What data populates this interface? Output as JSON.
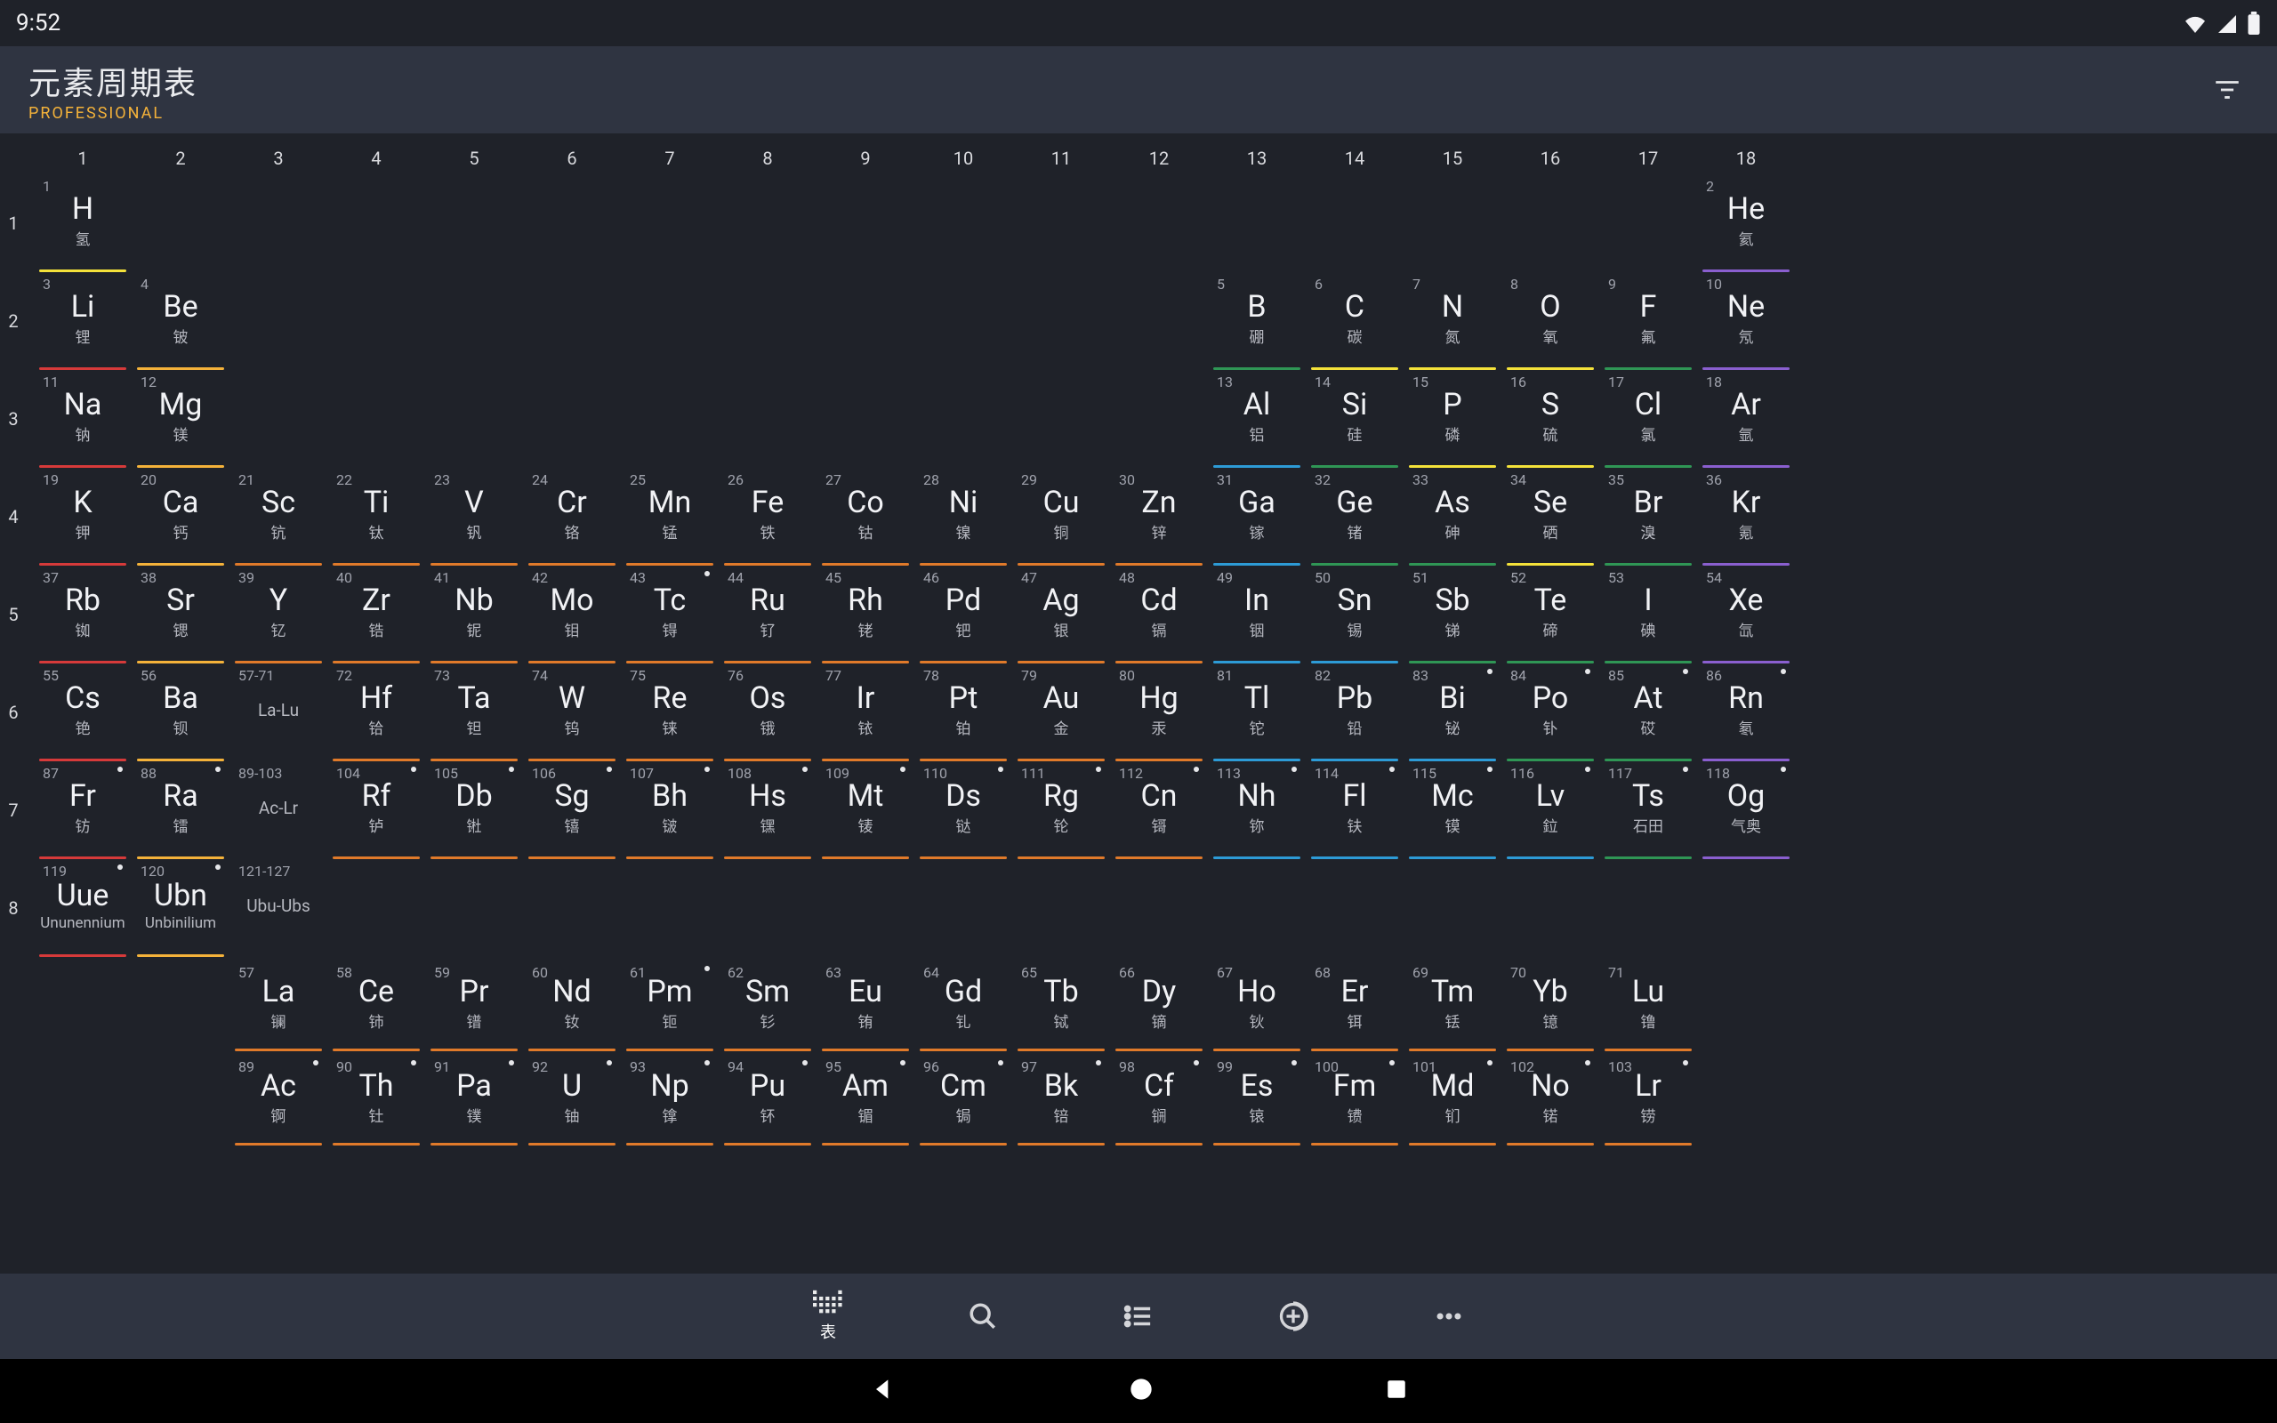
{
  "status": {
    "time": "9:52"
  },
  "header": {
    "title": "元素周期表",
    "subtitle": "PROFESSIONAL"
  },
  "nav": {
    "table": "表"
  },
  "colors": {
    "alkali": "#d63a3a",
    "alkaline": "#f4b23a",
    "transition": "#e07a2a",
    "post": "#2d9bd6",
    "metalloid": "#2f9655",
    "nonmetal": "#f4e23a",
    "halogen": "#2f9655",
    "noble": "#8a5fcf",
    "lanth": "#e07a2a",
    "actin": "#e07a2a",
    "unknown": "#8a5fcf"
  },
  "groups": [
    "1",
    "2",
    "3",
    "4",
    "5",
    "6",
    "7",
    "8",
    "9",
    "10",
    "11",
    "12",
    "13",
    "14",
    "15",
    "16",
    "17",
    "18"
  ],
  "periods": [
    "1",
    "2",
    "3",
    "4",
    "5",
    "6",
    "7",
    "8"
  ],
  "elements": [
    {
      "n": "1",
      "s": "H",
      "cn": "氢",
      "r": 1,
      "c": 1,
      "cat": "nonmetal"
    },
    {
      "n": "2",
      "s": "He",
      "cn": "氦",
      "r": 1,
      "c": 18,
      "cat": "noble"
    },
    {
      "n": "3",
      "s": "Li",
      "cn": "锂",
      "r": 2,
      "c": 1,
      "cat": "alkali"
    },
    {
      "n": "4",
      "s": "Be",
      "cn": "铍",
      "r": 2,
      "c": 2,
      "cat": "alkaline"
    },
    {
      "n": "5",
      "s": "B",
      "cn": "硼",
      "r": 2,
      "c": 13,
      "cat": "metalloid"
    },
    {
      "n": "6",
      "s": "C",
      "cn": "碳",
      "r": 2,
      "c": 14,
      "cat": "nonmetal"
    },
    {
      "n": "7",
      "s": "N",
      "cn": "氮",
      "r": 2,
      "c": 15,
      "cat": "nonmetal"
    },
    {
      "n": "8",
      "s": "O",
      "cn": "氧",
      "r": 2,
      "c": 16,
      "cat": "nonmetal"
    },
    {
      "n": "9",
      "s": "F",
      "cn": "氟",
      "r": 2,
      "c": 17,
      "cat": "halogen"
    },
    {
      "n": "10",
      "s": "Ne",
      "cn": "氖",
      "r": 2,
      "c": 18,
      "cat": "noble"
    },
    {
      "n": "11",
      "s": "Na",
      "cn": "钠",
      "r": 3,
      "c": 1,
      "cat": "alkali"
    },
    {
      "n": "12",
      "s": "Mg",
      "cn": "镁",
      "r": 3,
      "c": 2,
      "cat": "alkaline"
    },
    {
      "n": "13",
      "s": "Al",
      "cn": "铝",
      "r": 3,
      "c": 13,
      "cat": "post"
    },
    {
      "n": "14",
      "s": "Si",
      "cn": "硅",
      "r": 3,
      "c": 14,
      "cat": "metalloid"
    },
    {
      "n": "15",
      "s": "P",
      "cn": "磷",
      "r": 3,
      "c": 15,
      "cat": "nonmetal"
    },
    {
      "n": "16",
      "s": "S",
      "cn": "硫",
      "r": 3,
      "c": 16,
      "cat": "nonmetal"
    },
    {
      "n": "17",
      "s": "Cl",
      "cn": "氯",
      "r": 3,
      "c": 17,
      "cat": "halogen"
    },
    {
      "n": "18",
      "s": "Ar",
      "cn": "氩",
      "r": 3,
      "c": 18,
      "cat": "noble"
    },
    {
      "n": "19",
      "s": "K",
      "cn": "钾",
      "r": 4,
      "c": 1,
      "cat": "alkali"
    },
    {
      "n": "20",
      "s": "Ca",
      "cn": "钙",
      "r": 4,
      "c": 2,
      "cat": "alkaline"
    },
    {
      "n": "21",
      "s": "Sc",
      "cn": "钪",
      "r": 4,
      "c": 3,
      "cat": "transition"
    },
    {
      "n": "22",
      "s": "Ti",
      "cn": "钛",
      "r": 4,
      "c": 4,
      "cat": "transition"
    },
    {
      "n": "23",
      "s": "V",
      "cn": "钒",
      "r": 4,
      "c": 5,
      "cat": "transition"
    },
    {
      "n": "24",
      "s": "Cr",
      "cn": "铬",
      "r": 4,
      "c": 6,
      "cat": "transition"
    },
    {
      "n": "25",
      "s": "Mn",
      "cn": "锰",
      "r": 4,
      "c": 7,
      "cat": "transition"
    },
    {
      "n": "26",
      "s": "Fe",
      "cn": "铁",
      "r": 4,
      "c": 8,
      "cat": "transition"
    },
    {
      "n": "27",
      "s": "Co",
      "cn": "钴",
      "r": 4,
      "c": 9,
      "cat": "transition"
    },
    {
      "n": "28",
      "s": "Ni",
      "cn": "镍",
      "r": 4,
      "c": 10,
      "cat": "transition"
    },
    {
      "n": "29",
      "s": "Cu",
      "cn": "铜",
      "r": 4,
      "c": 11,
      "cat": "transition"
    },
    {
      "n": "30",
      "s": "Zn",
      "cn": "锌",
      "r": 4,
      "c": 12,
      "cat": "transition"
    },
    {
      "n": "31",
      "s": "Ga",
      "cn": "镓",
      "r": 4,
      "c": 13,
      "cat": "post"
    },
    {
      "n": "32",
      "s": "Ge",
      "cn": "锗",
      "r": 4,
      "c": 14,
      "cat": "metalloid"
    },
    {
      "n": "33",
      "s": "As",
      "cn": "砷",
      "r": 4,
      "c": 15,
      "cat": "metalloid"
    },
    {
      "n": "34",
      "s": "Se",
      "cn": "硒",
      "r": 4,
      "c": 16,
      "cat": "nonmetal"
    },
    {
      "n": "35",
      "s": "Br",
      "cn": "溴",
      "r": 4,
      "c": 17,
      "cat": "halogen"
    },
    {
      "n": "36",
      "s": "Kr",
      "cn": "氪",
      "r": 4,
      "c": 18,
      "cat": "noble"
    },
    {
      "n": "37",
      "s": "Rb",
      "cn": "铷",
      "r": 5,
      "c": 1,
      "cat": "alkali"
    },
    {
      "n": "38",
      "s": "Sr",
      "cn": "锶",
      "r": 5,
      "c": 2,
      "cat": "alkaline"
    },
    {
      "n": "39",
      "s": "Y",
      "cn": "钇",
      "r": 5,
      "c": 3,
      "cat": "transition"
    },
    {
      "n": "40",
      "s": "Zr",
      "cn": "锆",
      "r": 5,
      "c": 4,
      "cat": "transition"
    },
    {
      "n": "41",
      "s": "Nb",
      "cn": "铌",
      "r": 5,
      "c": 5,
      "cat": "transition"
    },
    {
      "n": "42",
      "s": "Mo",
      "cn": "钼",
      "r": 5,
      "c": 6,
      "cat": "transition"
    },
    {
      "n": "43",
      "s": "Tc",
      "cn": "锝",
      "r": 5,
      "c": 7,
      "cat": "transition",
      "dot": true
    },
    {
      "n": "44",
      "s": "Ru",
      "cn": "钌",
      "r": 5,
      "c": 8,
      "cat": "transition"
    },
    {
      "n": "45",
      "s": "Rh",
      "cn": "铑",
      "r": 5,
      "c": 9,
      "cat": "transition"
    },
    {
      "n": "46",
      "s": "Pd",
      "cn": "钯",
      "r": 5,
      "c": 10,
      "cat": "transition"
    },
    {
      "n": "47",
      "s": "Ag",
      "cn": "银",
      "r": 5,
      "c": 11,
      "cat": "transition"
    },
    {
      "n": "48",
      "s": "Cd",
      "cn": "镉",
      "r": 5,
      "c": 12,
      "cat": "transition"
    },
    {
      "n": "49",
      "s": "In",
      "cn": "铟",
      "r": 5,
      "c": 13,
      "cat": "post"
    },
    {
      "n": "50",
      "s": "Sn",
      "cn": "锡",
      "r": 5,
      "c": 14,
      "cat": "post"
    },
    {
      "n": "51",
      "s": "Sb",
      "cn": "锑",
      "r": 5,
      "c": 15,
      "cat": "metalloid"
    },
    {
      "n": "52",
      "s": "Te",
      "cn": "碲",
      "r": 5,
      "c": 16,
      "cat": "metalloid"
    },
    {
      "n": "53",
      "s": "I",
      "cn": "碘",
      "r": 5,
      "c": 17,
      "cat": "halogen"
    },
    {
      "n": "54",
      "s": "Xe",
      "cn": "氙",
      "r": 5,
      "c": 18,
      "cat": "noble"
    },
    {
      "n": "55",
      "s": "Cs",
      "cn": "铯",
      "r": 6,
      "c": 1,
      "cat": "alkali"
    },
    {
      "n": "56",
      "s": "Ba",
      "cn": "钡",
      "r": 6,
      "c": 2,
      "cat": "alkaline"
    },
    {
      "n": "57-71",
      "s": "La-Lu",
      "sub": "",
      "r": 6,
      "c": 3,
      "cat": "lanth",
      "placeholder": true
    },
    {
      "n": "72",
      "s": "Hf",
      "cn": "铪",
      "r": 6,
      "c": 4,
      "cat": "transition"
    },
    {
      "n": "73",
      "s": "Ta",
      "cn": "钽",
      "r": 6,
      "c": 5,
      "cat": "transition"
    },
    {
      "n": "74",
      "s": "W",
      "cn": "钨",
      "r": 6,
      "c": 6,
      "cat": "transition"
    },
    {
      "n": "75",
      "s": "Re",
      "cn": "铼",
      "r": 6,
      "c": 7,
      "cat": "transition"
    },
    {
      "n": "76",
      "s": "Os",
      "cn": "锇",
      "r": 6,
      "c": 8,
      "cat": "transition"
    },
    {
      "n": "77",
      "s": "Ir",
      "cn": "铱",
      "r": 6,
      "c": 9,
      "cat": "transition"
    },
    {
      "n": "78",
      "s": "Pt",
      "cn": "铂",
      "r": 6,
      "c": 10,
      "cat": "transition"
    },
    {
      "n": "79",
      "s": "Au",
      "cn": "金",
      "r": 6,
      "c": 11,
      "cat": "transition"
    },
    {
      "n": "80",
      "s": "Hg",
      "cn": "汞",
      "r": 6,
      "c": 12,
      "cat": "transition"
    },
    {
      "n": "81",
      "s": "Tl",
      "cn": "铊",
      "r": 6,
      "c": 13,
      "cat": "post"
    },
    {
      "n": "82",
      "s": "Pb",
      "cn": "铅",
      "r": 6,
      "c": 14,
      "cat": "post"
    },
    {
      "n": "83",
      "s": "Bi",
      "cn": "铋",
      "r": 6,
      "c": 15,
      "cat": "post",
      "dot": true
    },
    {
      "n": "84",
      "s": "Po",
      "cn": "钋",
      "r": 6,
      "c": 16,
      "cat": "metalloid",
      "dot": true
    },
    {
      "n": "85",
      "s": "At",
      "cn": "砹",
      "r": 6,
      "c": 17,
      "cat": "halogen",
      "dot": true
    },
    {
      "n": "86",
      "s": "Rn",
      "cn": "氡",
      "r": 6,
      "c": 18,
      "cat": "noble",
      "dot": true
    },
    {
      "n": "87",
      "s": "Fr",
      "cn": "钫",
      "r": 7,
      "c": 1,
      "cat": "alkali",
      "dot": true
    },
    {
      "n": "88",
      "s": "Ra",
      "cn": "镭",
      "r": 7,
      "c": 2,
      "cat": "alkaline",
      "dot": true
    },
    {
      "n": "89-103",
      "s": "Ac-Lr",
      "sub": "",
      "r": 7,
      "c": 3,
      "cat": "actin",
      "placeholder": true
    },
    {
      "n": "104",
      "s": "Rf",
      "cn": "𬬻",
      "r": 7,
      "c": 4,
      "cat": "transition",
      "dot": true
    },
    {
      "n": "105",
      "s": "Db",
      "cn": "𬭊",
      "r": 7,
      "c": 5,
      "cat": "transition",
      "dot": true
    },
    {
      "n": "106",
      "s": "Sg",
      "cn": "𬭳",
      "r": 7,
      "c": 6,
      "cat": "transition",
      "dot": true
    },
    {
      "n": "107",
      "s": "Bh",
      "cn": "𬭛",
      "r": 7,
      "c": 7,
      "cat": "transition",
      "dot": true
    },
    {
      "n": "108",
      "s": "Hs",
      "cn": "𬭶",
      "r": 7,
      "c": 8,
      "cat": "transition",
      "dot": true
    },
    {
      "n": "109",
      "s": "Mt",
      "cn": "鿏",
      "r": 7,
      "c": 9,
      "cat": "transition",
      "dot": true
    },
    {
      "n": "110",
      "s": "Ds",
      "cn": "𫟼",
      "r": 7,
      "c": 10,
      "cat": "transition",
      "dot": true
    },
    {
      "n": "111",
      "s": "Rg",
      "cn": "𬬭",
      "r": 7,
      "c": 11,
      "cat": "transition",
      "dot": true
    },
    {
      "n": "112",
      "s": "Cn",
      "cn": "鿔",
      "r": 7,
      "c": 12,
      "cat": "transition",
      "dot": true
    },
    {
      "n": "113",
      "s": "Nh",
      "cn": "鿭",
      "r": 7,
      "c": 13,
      "cat": "post",
      "dot": true
    },
    {
      "n": "114",
      "s": "Fl",
      "cn": "𫓧",
      "r": 7,
      "c": 14,
      "cat": "post",
      "dot": true
    },
    {
      "n": "115",
      "s": "Mc",
      "cn": "镆",
      "r": 7,
      "c": 15,
      "cat": "post",
      "dot": true
    },
    {
      "n": "116",
      "s": "Lv",
      "cn": "鉝",
      "r": 7,
      "c": 16,
      "cat": "post",
      "dot": true
    },
    {
      "n": "117",
      "s": "Ts",
      "cn": "石田",
      "r": 7,
      "c": 17,
      "cat": "halogen",
      "dot": true
    },
    {
      "n": "118",
      "s": "Og",
      "cn": "气奥",
      "r": 7,
      "c": 18,
      "cat": "noble",
      "dot": true
    },
    {
      "n": "119",
      "s": "Uue",
      "cn": "Ununennium",
      "r": 8,
      "c": 1,
      "cat": "alkali",
      "dot": true
    },
    {
      "n": "120",
      "s": "Ubn",
      "cn": "Unbinilium",
      "r": 8,
      "c": 2,
      "cat": "alkaline",
      "dot": true
    },
    {
      "n": "121-127",
      "s": "Ubu-Ubs",
      "sub": "",
      "r": 8,
      "c": 3,
      "cat": "unknown",
      "placeholder": true
    }
  ],
  "lanthanides": [
    {
      "n": "57",
      "s": "La",
      "cn": "镧"
    },
    {
      "n": "58",
      "s": "Ce",
      "cn": "铈"
    },
    {
      "n": "59",
      "s": "Pr",
      "cn": "镨"
    },
    {
      "n": "60",
      "s": "Nd",
      "cn": "钕"
    },
    {
      "n": "61",
      "s": "Pm",
      "cn": "钷",
      "dot": true
    },
    {
      "n": "62",
      "s": "Sm",
      "cn": "钐"
    },
    {
      "n": "63",
      "s": "Eu",
      "cn": "铕"
    },
    {
      "n": "64",
      "s": "Gd",
      "cn": "钆"
    },
    {
      "n": "65",
      "s": "Tb",
      "cn": "铽"
    },
    {
      "n": "66",
      "s": "Dy",
      "cn": "镝"
    },
    {
      "n": "67",
      "s": "Ho",
      "cn": "钬"
    },
    {
      "n": "68",
      "s": "Er",
      "cn": "铒"
    },
    {
      "n": "69",
      "s": "Tm",
      "cn": "铥"
    },
    {
      "n": "70",
      "s": "Yb",
      "cn": "镱"
    },
    {
      "n": "71",
      "s": "Lu",
      "cn": "镥"
    }
  ],
  "actinides": [
    {
      "n": "89",
      "s": "Ac",
      "cn": "锕",
      "dot": true
    },
    {
      "n": "90",
      "s": "Th",
      "cn": "钍",
      "dot": true
    },
    {
      "n": "91",
      "s": "Pa",
      "cn": "镤",
      "dot": true
    },
    {
      "n": "92",
      "s": "U",
      "cn": "铀",
      "dot": true
    },
    {
      "n": "93",
      "s": "Np",
      "cn": "镎",
      "dot": true
    },
    {
      "n": "94",
      "s": "Pu",
      "cn": "钚",
      "dot": true
    },
    {
      "n": "95",
      "s": "Am",
      "cn": "镅",
      "dot": true
    },
    {
      "n": "96",
      "s": "Cm",
      "cn": "锔",
      "dot": true
    },
    {
      "n": "97",
      "s": "Bk",
      "cn": "锫",
      "dot": true
    },
    {
      "n": "98",
      "s": "Cf",
      "cn": "锎",
      "dot": true
    },
    {
      "n": "99",
      "s": "Es",
      "cn": "锿",
      "dot": true
    },
    {
      "n": "100",
      "s": "Fm",
      "cn": "镄",
      "dot": true
    },
    {
      "n": "101",
      "s": "Md",
      "cn": "钔",
      "dot": true
    },
    {
      "n": "102",
      "s": "No",
      "cn": "锘",
      "dot": true
    },
    {
      "n": "103",
      "s": "Lr",
      "cn": "铹",
      "dot": true
    }
  ]
}
